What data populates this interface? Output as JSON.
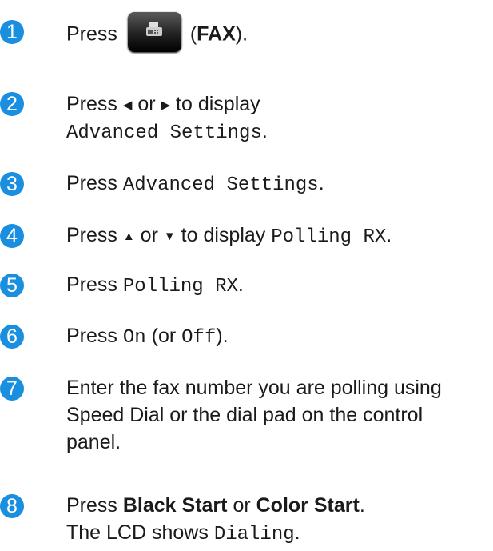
{
  "steps": [
    {
      "n": "1",
      "press": "Press",
      "fax_open": "(",
      "fax": "FAX",
      "fax_close": ")."
    },
    {
      "n": "2",
      "press": "Press",
      "left_tri": "◀",
      "or": "or",
      "right_tri": "▶",
      "to_display": "to display",
      "setting": "Advanced Settings",
      "period": "."
    },
    {
      "n": "3",
      "press": "Press",
      "setting": "Advanced Settings",
      "period": "."
    },
    {
      "n": "4",
      "press": "Press",
      "up_tri": "▲",
      "or": "or",
      "down_tri": "▼",
      "to_display": "to display",
      "setting": "Polling RX",
      "period": "."
    },
    {
      "n": "5",
      "press": "Press",
      "setting": "Polling RX",
      "period": "."
    },
    {
      "n": "6",
      "press": "Press",
      "on": "On",
      "or_open": "(or",
      "off": "Off",
      "close": ")."
    },
    {
      "n": "7",
      "text": "Enter the fax number you are polling using Speed Dial or the dial pad on the control panel."
    },
    {
      "n": "8",
      "press": "Press",
      "black_start": "Black Start",
      "or": "or",
      "color_start": "Color Start",
      "period": ".",
      "lcd_shows": "The LCD shows",
      "dialing": "Dialing",
      "period2": "."
    }
  ],
  "fax_icon": "fax-machine-icon",
  "accent_color": "#1a8fe0"
}
